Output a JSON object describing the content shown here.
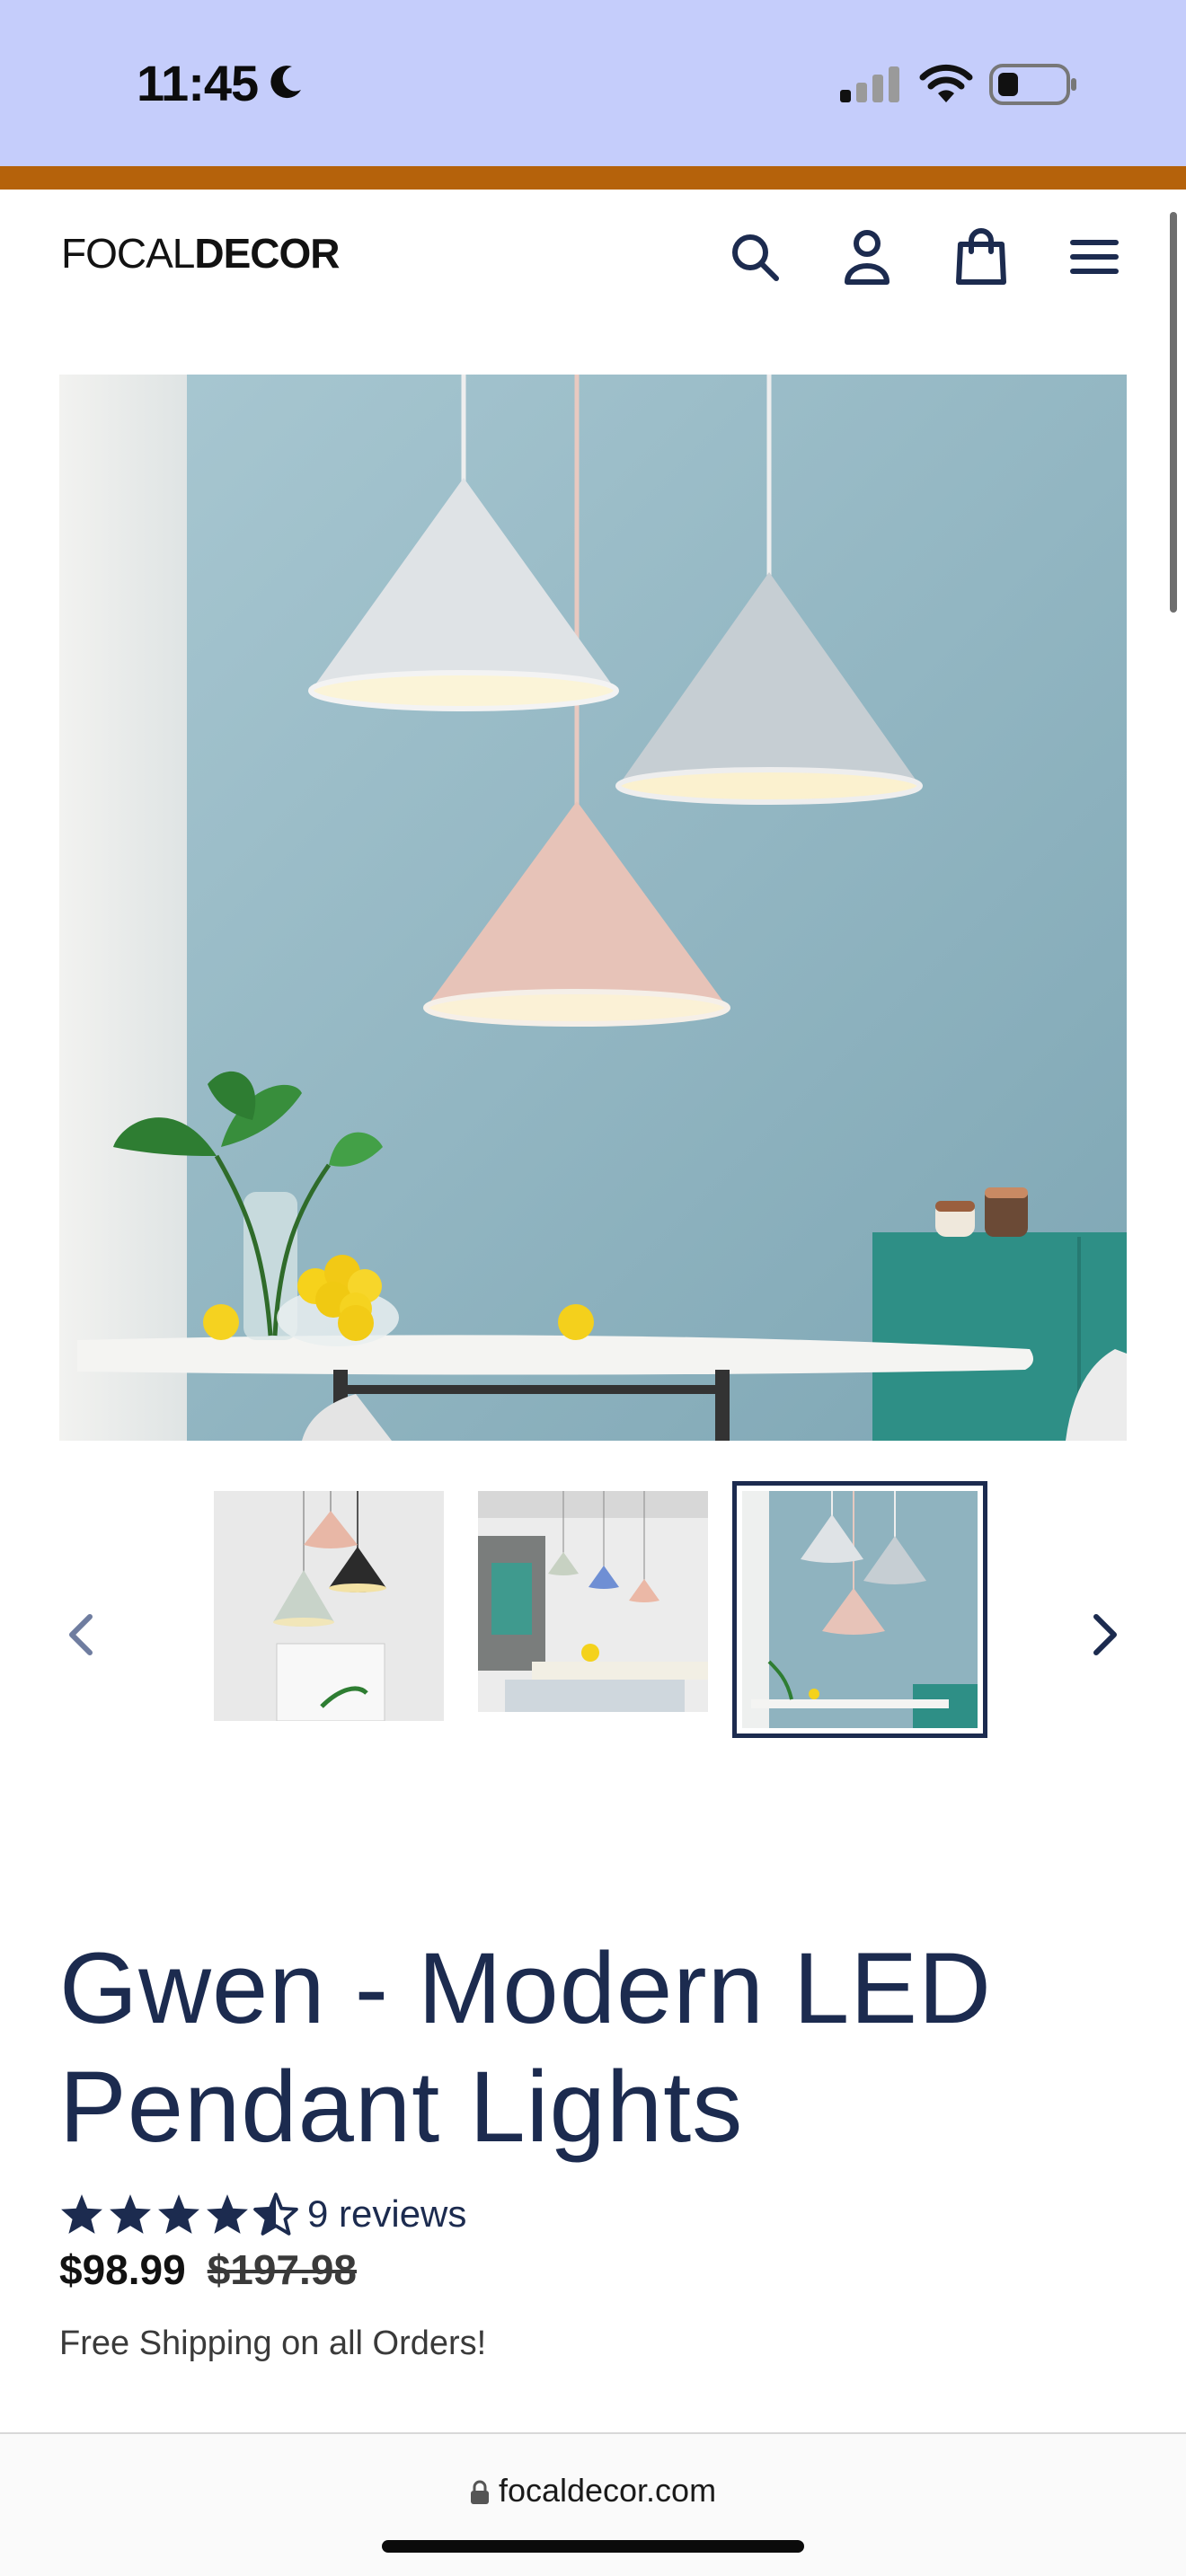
{
  "status_bar": {
    "time": "11:45"
  },
  "header": {
    "logo_light": "FOCAL",
    "logo_bold": "DECOR"
  },
  "gallery": {
    "thumbnail_count": 3,
    "active_thumbnail_index": 2
  },
  "product": {
    "title": "Gwen - Modern LED Pendant Lights",
    "rating": 4.5,
    "reviews_label": "9 reviews",
    "sale_price": "$98.99",
    "regular_price": "$197.98",
    "shipping_note": "Free Shipping on all Orders!"
  },
  "browser": {
    "url": "focaldecor.com"
  },
  "colors": {
    "status_bg": "#c5cdfb",
    "accent_strip": "#b5620b",
    "brand_navy": "#1c2b4f",
    "wall_blue": "#8fb3bf",
    "teal_cabinet": "#2e8f86"
  }
}
